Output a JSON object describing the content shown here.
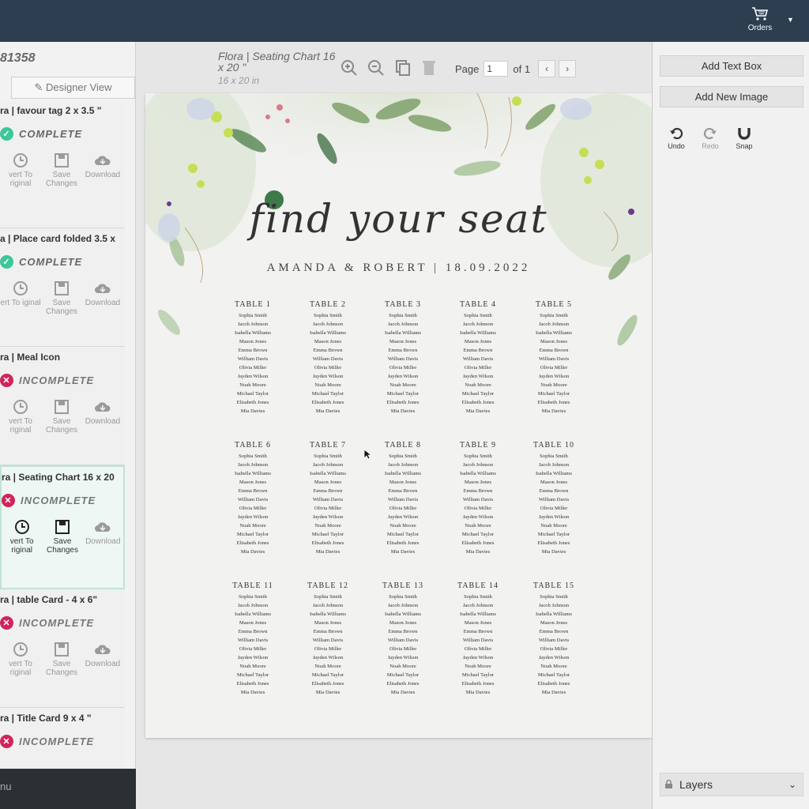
{
  "topbar": {
    "orders_label": "Orders",
    "cart_icon": "cart-icon"
  },
  "left_panel": {
    "order_id": "81358",
    "designer_tab": "Designer View",
    "products": [
      {
        "title": "ra | favour tag 2 x 3.5 \"",
        "status": "COMPLETE",
        "status_type": "complete",
        "actions": [
          "vert To riginal",
          "Save Changes",
          "Download"
        ]
      },
      {
        "title": "a | Place card folded 3.5 x",
        "status": "COMPLETE",
        "status_type": "complete",
        "actions": [
          "ert To iginal",
          "Save Changes",
          "Download"
        ]
      },
      {
        "title": "ra | Meal Icon",
        "status": "INCOMPLETE",
        "status_type": "incomplete",
        "actions": [
          "vert To riginal",
          "Save Changes",
          "Download"
        ]
      },
      {
        "title": "ra | Seating Chart 16 x 20",
        "status": "INCOMPLETE",
        "status_type": "incomplete",
        "actions": [
          "vert To riginal",
          "Save Changes",
          "Download"
        ]
      },
      {
        "title": "ra | table Card - 4 x 6\"",
        "status": "INCOMPLETE",
        "status_type": "incomplete",
        "actions": [
          "vert To riginal",
          "Save Changes",
          "Download"
        ]
      },
      {
        "title": "ra | Title Card 9 x 4 \"",
        "status": "INCOMPLETE",
        "status_type": "incomplete",
        "actions": []
      }
    ],
    "bottom_text": "nu"
  },
  "editor": {
    "doc_title": "Flora | Seating Chart 16 x 20 \"",
    "doc_size": "16 x 20 in",
    "page_label": "Page",
    "page_value": "1",
    "page_of": "of 1"
  },
  "sheet": {
    "heading": "find your seat",
    "couple": "AMANDA & ROBERT | 18.09.2022",
    "table_labels": [
      "TABLE 1",
      "TABLE 2",
      "TABLE 3",
      "TABLE 4",
      "TABLE 5",
      "TABLE 6",
      "TABLE 7",
      "TABLE 8",
      "TABLE 9",
      "TABLE 10",
      "TABLE 11",
      "TABLE 12",
      "TABLE 13",
      "TABLE 14",
      "TABLE 15"
    ],
    "guests": [
      "Sophia Smith",
      "Jacob Johnson",
      "Isabella Williams",
      "Mason Jones",
      "Emma Brown",
      "William Davis",
      "Olivia Miller",
      "Jayden Wilson",
      "Noah Moore",
      "Michael Taylor",
      "Elisabeth Jones",
      "Mia Davies"
    ]
  },
  "right_panel": {
    "add_text_box": "Add Text Box",
    "add_new_image": "Add New Image",
    "undo": "Undo",
    "redo": "Redo",
    "snap": "Snap",
    "layers": "Layers"
  },
  "colors": {
    "topbar": "#2c3e50",
    "complete": "#3cc796",
    "incomplete": "#d0245b",
    "active_outline": "#bfe3d8"
  }
}
